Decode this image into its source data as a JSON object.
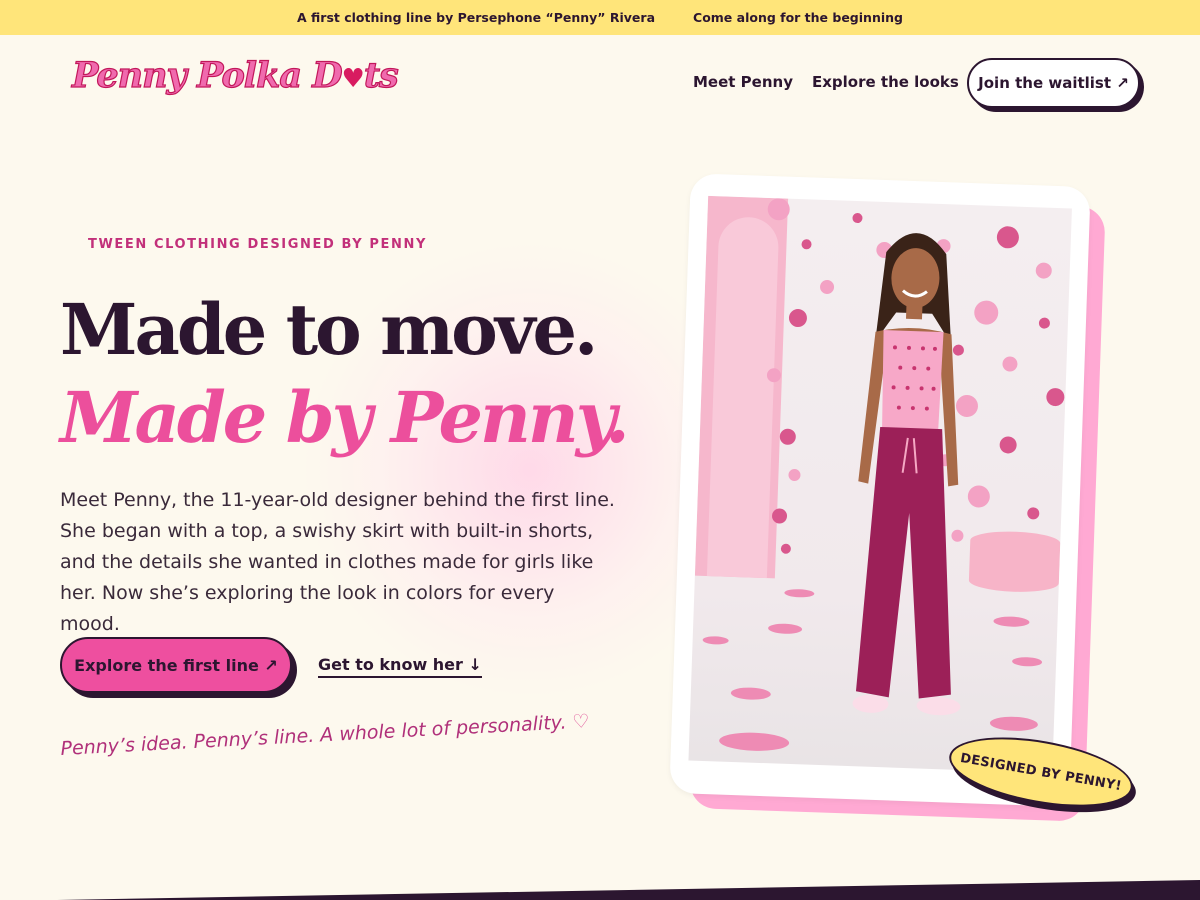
{
  "announcement": {
    "left": "A first clothing line by Persephone “Penny” Rivera",
    "right": "Come along for the beginning"
  },
  "brand": {
    "logo_part1": "Penny Polka D",
    "logo_heart": "♥",
    "logo_part2": "ts"
  },
  "nav": {
    "links": [
      "Meet Penny",
      "Explore the looks"
    ],
    "cta": "Join the waitlist ↗"
  },
  "hero": {
    "eyebrow": "TWEEN CLOTHING DESIGNED BY PENNY",
    "headline_line1": "Made to move.",
    "headline_line2": "Made by Penny.",
    "description": "Meet Penny, the 11-year-old designer behind the first line. She began with a top, a swishy skirt with built-in shorts, and the details she wanted in clothes made for girls like her. Now she’s exploring the look in colors for every mood.",
    "primary_cta": "Explore the first line ↗",
    "secondary_cta": "Get to know her ↓",
    "tagline": "Penny’s idea. Penny’s line. A whole lot of personality.",
    "tagline_heart": "♡",
    "badge": "DESIGNED BY PENNY!"
  },
  "colors": {
    "accent_pink": "#ee4f9f",
    "dark": "#2c1630",
    "yellow": "#ffe57a",
    "background": "#fdf9ee"
  }
}
